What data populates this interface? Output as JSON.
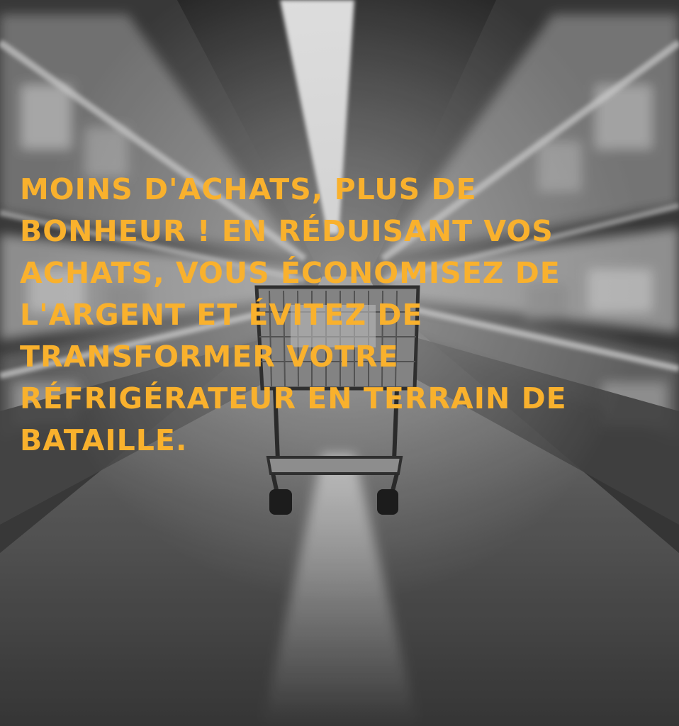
{
  "headline": {
    "text": "MOINS D'ACHATS, PLUS DE\nBONHEUR ! EN RÉDUISANT VOS\nACHATS, VOUS ÉCONOMISEZ DE\nL'ARGENT ET ÉVITEZ DE\nTRANSFORMER VOTRE\nRÉFRIGÉRATEUR EN TERRAIN DE\nBATAILLE.",
    "color": "#f9b12d"
  },
  "scene": {
    "subject": "shopping-cart-in-supermarket-aisle",
    "palette": "grayscale"
  }
}
